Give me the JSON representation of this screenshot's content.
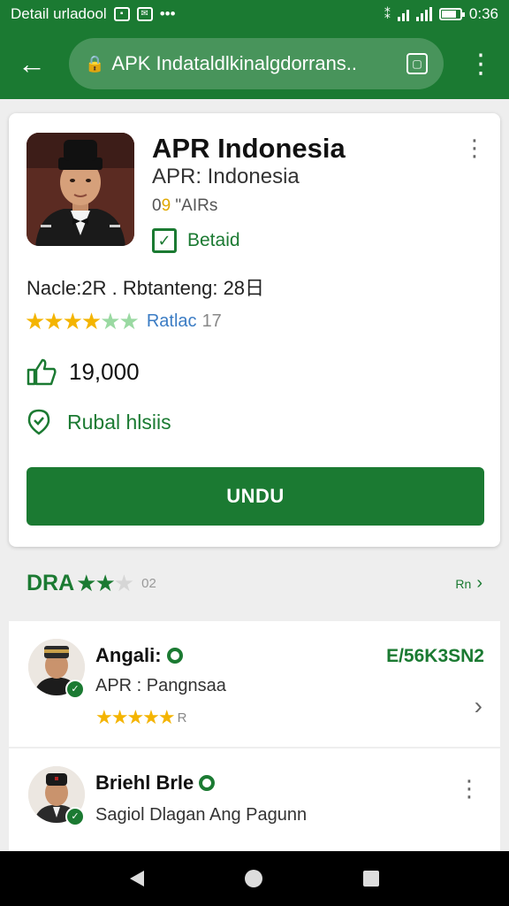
{
  "status_bar": {
    "left_text": "Detail urladool",
    "time": "0:36",
    "battery_level": 0.8
  },
  "app_bar": {
    "url": "APK Indataldlkinalgdorrans.."
  },
  "app": {
    "title": "APR Indonesia",
    "subtitle": "APR: Indonesia",
    "meta_prefix": "0",
    "meta_highlight": "9",
    "meta_suffix": " \"AIRs",
    "verified_label": "Betaid",
    "size_line": "Nacle:2R . Rbtanteng: 28日",
    "rating_stars": 4.5,
    "rating_label": "Ratlac",
    "rating_count": "17",
    "downloads": "19,000",
    "report_label": "Rubal hlsiis",
    "install_label": "UNDU"
  },
  "reviews": {
    "title": "DRA",
    "stars": 2,
    "count": "02",
    "see_all": "Rn",
    "items": [
      {
        "name": "Angali:",
        "tag": "E/56K3SN2",
        "text": "APR : Pangnsaa",
        "stars": 5,
        "extra": "R"
      },
      {
        "name": "Briehl Brle",
        "text": "Sagiol Dlagan Ang Pagunn"
      }
    ]
  },
  "colors": {
    "primary": "#1b7a32",
    "star": "#f4b400",
    "link": "#3b7cc4"
  }
}
